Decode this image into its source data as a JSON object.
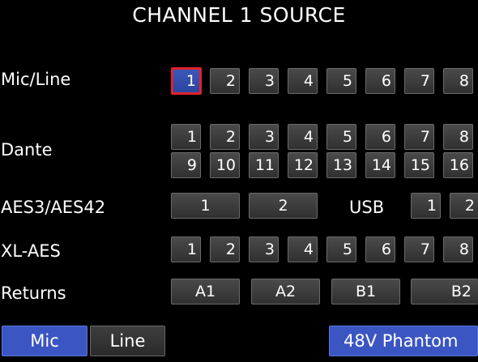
{
  "title": "CHANNEL 1 SOURCE",
  "rows": {
    "mic_line": {
      "label": "Mic/Line",
      "buttons": [
        "1",
        "2",
        "3",
        "4",
        "5",
        "6",
        "7",
        "8"
      ],
      "selected": "1"
    },
    "dante": {
      "label": "Dante",
      "buttons": [
        "1",
        "2",
        "3",
        "4",
        "5",
        "6",
        "7",
        "8",
        "9",
        "10",
        "11",
        "12",
        "13",
        "14",
        "15",
        "16"
      ]
    },
    "aes": {
      "label": "AES3/AES42",
      "buttons": [
        "1",
        "2"
      ]
    },
    "usb": {
      "label": "USB",
      "buttons": [
        "1",
        "2"
      ]
    },
    "xl_aes": {
      "label": "XL-AES",
      "buttons": [
        "1",
        "2",
        "3",
        "4",
        "5",
        "6",
        "7",
        "8"
      ]
    },
    "returns": {
      "label": "Returns",
      "buttons": [
        "A1",
        "A2",
        "B1",
        "B2"
      ]
    }
  },
  "footer": {
    "mic": "Mic",
    "line": "Line",
    "phantom": "48V Phantom",
    "active_mode": "Mic"
  },
  "colors": {
    "selected_fill": "#2c44a0",
    "selected_border": "#e0222c",
    "active_mode": "#3b56c2",
    "button_fill": "#3c3c3c"
  }
}
